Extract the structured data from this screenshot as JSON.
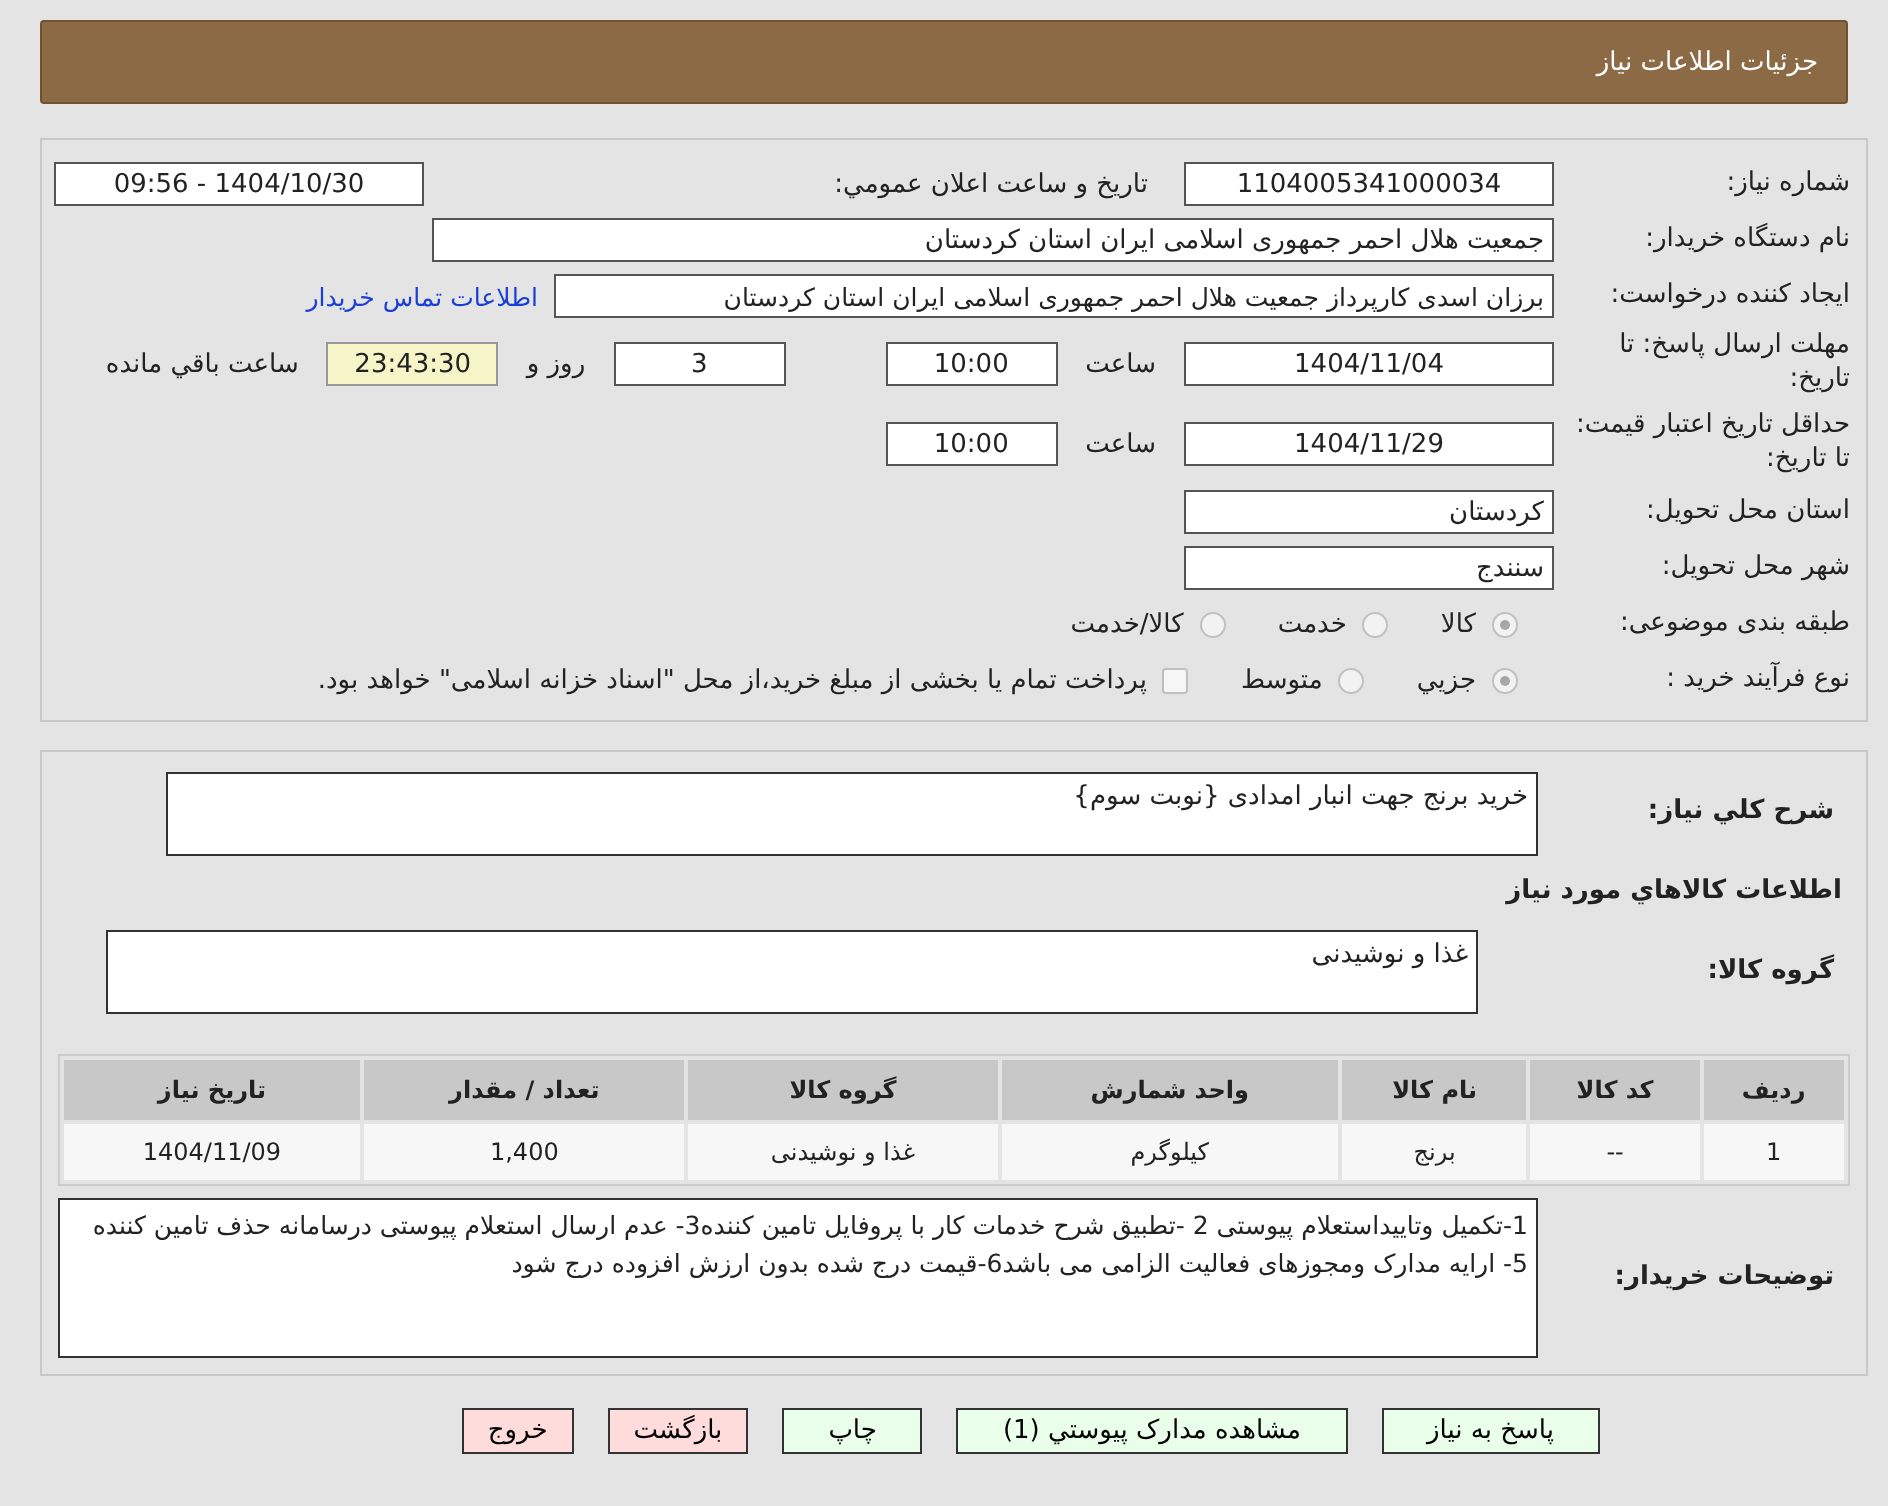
{
  "header": {
    "title": "جزئیات اطلاعات نیاز"
  },
  "need_number": {
    "label": "شماره نیاز:",
    "value": "1104005341000034"
  },
  "announce": {
    "label": "تاریخ و ساعت اعلان عمومي:",
    "value": "1404/10/30 - 09:56"
  },
  "buyer_org": {
    "label": "نام دستگاه خریدار:",
    "value": "جمعیت هلال احمر جمهوری اسلامی ایران استان کردستان"
  },
  "requester": {
    "label": "ایجاد کننده درخواست:",
    "value": "برزان اسدی کارپرداز جمعیت هلال احمر جمهوری اسلامی ایران استان کردستان",
    "link": "اطلاعات تماس خریدار"
  },
  "reply_deadline": {
    "label": "مهلت ارسال پاسخ: تا تاریخ:",
    "date": "1404/11/04",
    "time_label": "ساعت",
    "time": "10:00",
    "days": "3",
    "days_label": "روز و",
    "remaining": "23:43:30",
    "remaining_label": "ساعت باقي مانده"
  },
  "price_validity": {
    "label": "حداقل تاریخ اعتبار قیمت: تا تاریخ:",
    "date": "1404/11/29",
    "time_label": "ساعت",
    "time": "10:00"
  },
  "province": {
    "label": "استان محل تحویل:",
    "value": "کردستان"
  },
  "city": {
    "label": "شهر محل تحویل:",
    "value": "سنندج"
  },
  "category": {
    "label": "طبقه بندی موضوعی:",
    "options": [
      {
        "label": "کالا",
        "selected": true
      },
      {
        "label": "خدمت",
        "selected": false
      },
      {
        "label": "کالا/خدمت",
        "selected": false
      }
    ]
  },
  "purchase_type": {
    "label": "نوع فرآیند خرید :",
    "options": [
      {
        "label": "جزيي",
        "selected": true
      },
      {
        "label": "متوسط",
        "selected": false
      }
    ],
    "payment": {
      "checked": false,
      "label": "پرداخت تمام یا بخشی از مبلغ خرید،از محل \"اسناد خزانه اسلامی\" خواهد بود."
    }
  },
  "description": {
    "label": "شرح كلي نياز:",
    "value": "خرید برنج جهت انبار امدادی {نوبت سوم}"
  },
  "goods_title": "اطلاعات كالاهاي مورد نياز",
  "goods_group": {
    "label": "گروه کالا:",
    "value": "غذا و نوشیدنی"
  },
  "table": {
    "columns": [
      "ردیف",
      "کد کالا",
      "نام کالا",
      "واحد شمارش",
      "گروه کالا",
      "تعداد / مقدار",
      "تاریخ نیاز"
    ],
    "rows": [
      [
        "1",
        "--",
        "برنج",
        "کیلوگرم",
        "غذا و نوشیدنی",
        "1,400",
        "1404/11/09"
      ]
    ]
  },
  "notes": {
    "label": "توضیحات خریدار:",
    "value": "1-تکمیل وتاییداستعلام پیوستی 2 -تطبیق شرح خدمات کار با پروفایل تامین کننده3- عدم ارسال استعلام پیوستی درسامانه حذف تامین کننده 5- ارایه مدارک ومجوزهای فعالیت الزامی می باشد6-قیمت درج شده بدون ارزش افزوده درج شود"
  },
  "buttons": [
    {
      "label": "پاسخ به نیاز",
      "kind": "normal"
    },
    {
      "label": "مشاهده مدارک پیوستي (1)",
      "kind": "normal"
    },
    {
      "label": "چاپ",
      "kind": "normal"
    },
    {
      "label": "بازگشت",
      "kind": "danger"
    },
    {
      "label": "خروج",
      "kind": "danger"
    }
  ]
}
